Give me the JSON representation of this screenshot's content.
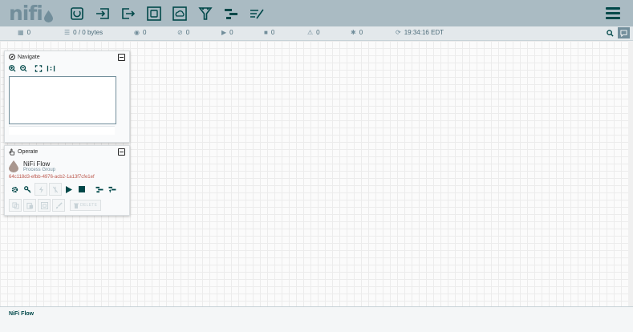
{
  "app": {
    "logo_text": "nifi"
  },
  "toolbar": {
    "components": [
      {
        "name": "processor",
        "icon": "processor-icon"
      },
      {
        "name": "input-port",
        "icon": "input-port-icon"
      },
      {
        "name": "output-port",
        "icon": "output-port-icon"
      },
      {
        "name": "process-group",
        "icon": "process-group-icon"
      },
      {
        "name": "remote-process-group",
        "icon": "remote-process-group-icon"
      },
      {
        "name": "funnel",
        "icon": "funnel-icon"
      },
      {
        "name": "template",
        "icon": "template-icon"
      },
      {
        "name": "label",
        "icon": "label-icon"
      }
    ]
  },
  "status": {
    "cluster_nodes": "0",
    "queued": "0 / 0 bytes",
    "transmitting": "0",
    "not_transmitting": "0",
    "running": "0",
    "stopped": "0",
    "invalid": "0",
    "disabled": "0",
    "refreshed": "19:34:16 EDT"
  },
  "navigate": {
    "title": "Navigate"
  },
  "operate": {
    "title": "Operate",
    "selection_name": "NiFi Flow",
    "selection_type": "Process Group",
    "selection_id": "64c118d3-efbb-4976-acb2-1a13f7cfe1ef",
    "delete_label": "DELETE"
  },
  "breadcrumb": {
    "current": "NiFi Flow"
  },
  "colors": {
    "header": "#aabbc3",
    "accent": "#004849",
    "muted": "#728e9b",
    "id_text": "#ba554a"
  }
}
